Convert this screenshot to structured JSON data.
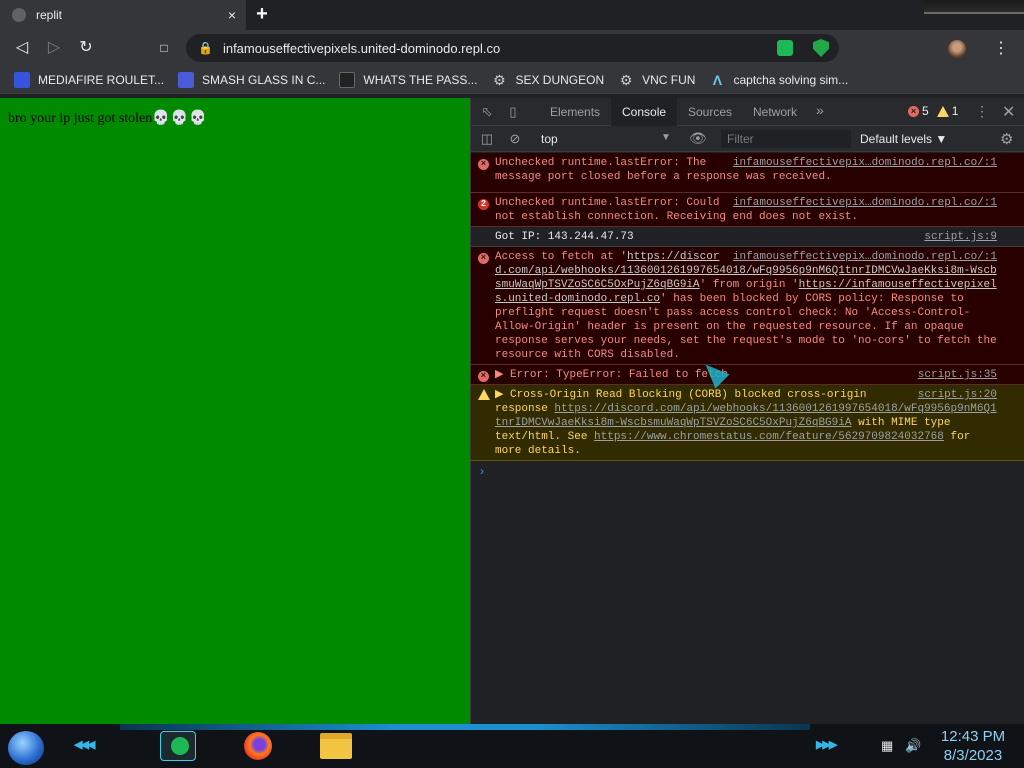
{
  "tab": {
    "title": "replit",
    "close": "×",
    "new_tab": "+"
  },
  "toolbar": {
    "back": "◁",
    "forward": "▷",
    "reload": "↻",
    "bookmark": "🔖",
    "url": "infamouseffectivepixels.united-dominodo.repl.co",
    "menu": "⋮"
  },
  "bookmarks": [
    {
      "label": "MEDIAFIRE ROULET...",
      "icon": "mediafire-icon",
      "color": "#3355dd"
    },
    {
      "label": "SMASH GLASS IN C...",
      "icon": "smash-glass-icon",
      "color": "#4a5bd8"
    },
    {
      "label": "WHATS THE PASS...",
      "icon": "dark-square-icon",
      "color": "#222222"
    },
    {
      "label": "SEX DUNGEON",
      "icon": "gear-icon",
      "color": "#cccccc"
    },
    {
      "label": "VNC FUN",
      "icon": "gear-icon",
      "color": "#cccccc"
    },
    {
      "label": "captcha solving sim...",
      "icon": "a-logo-icon",
      "color": "#6cc6e8"
    }
  ],
  "page": {
    "message": "bro your ip just got stolen",
    "emoji": "💀💀💀",
    "background": "#008a00"
  },
  "devtools": {
    "tabs": [
      "Elements",
      "Console",
      "Sources",
      "Network"
    ],
    "active_tab": "Console",
    "more": "»",
    "error_count": "5",
    "warning_count": "1",
    "context": "top",
    "filter_placeholder": "Filter",
    "levels": "Default levels ▼",
    "messages": [
      {
        "level": "error",
        "text": "Unchecked runtime.lastError: The message port closed before a response was received.",
        "source": "infamouseffectivepix…dominodo.repl.co/:1"
      },
      {
        "level": "error",
        "badge": "2",
        "text": "Unchecked runtime.lastError: Could not establish connection. Receiving end does not exist.",
        "source": "infamouseffectivepix…dominodo.repl.co/:1"
      },
      {
        "level": "info",
        "text": "Got IP: 143.244.47.73",
        "source": "script.js:9"
      },
      {
        "level": "error",
        "pre": "Access to fetch at '",
        "link1": "https://discord.com/api/webhooks/1136001261997654018/wFq9956p9nM6Q1tnrIDMCVwJaeKksi8m-WscbsmuWaqWpTSVZoSC6C5OxPujZ6qBG9iA",
        "mid": "' from origin '",
        "link2": "https://infamouseffectivepixels.united-dominodo.repl.co",
        "post": "' has been blocked by CORS policy: Response to preflight request doesn't pass access control check: No 'Access-Control-Allow-Origin' header is present on the requested resource. If an opaque response serves your needs, set the request's mode to 'no-cors' to fetch the resource with CORS disabled.",
        "source": "infamouseffectivepix…dominodo.repl.co/:1"
      },
      {
        "level": "error",
        "text": "▶ Error: TypeError: Failed to fetch",
        "source": "script.js:35"
      },
      {
        "level": "warn",
        "pre": "▶ Cross-Origin Read Blocking (CORB) blocked cross-origin response ",
        "link1": "https://discord.com/api/webhooks/1136001261997654018/wFq9956p9nM6Q1tnrIDMCVwJaeKksi8m-WscbsmuWaqWpTSVZoSC6C5OxPujZ6qBG9iA",
        "mid": " with MIME type text/html. See ",
        "link2": "https://www.chromestatus.com/feature/5629709824032768",
        "post": " for more details.",
        "source": "script.js:20"
      }
    ],
    "prompt": "›"
  },
  "taskbar": {
    "time": "12:43 PM",
    "date": "8/3/2023"
  },
  "colors": {
    "accent": "#1c8fd0",
    "error_bg": "#290000",
    "error_text": "#f28b82",
    "warn_bg": "#332b00",
    "warn_text": "#fdd663"
  }
}
